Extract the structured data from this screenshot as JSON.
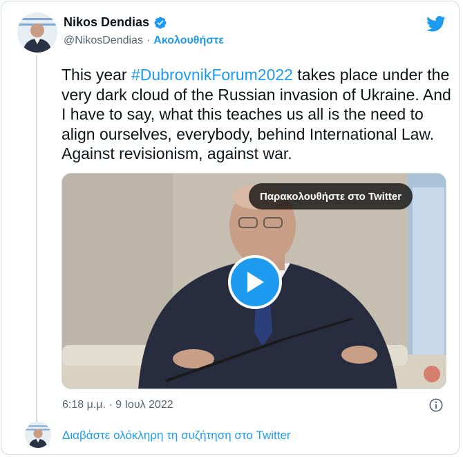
{
  "author": {
    "name": "Nikos Dendias",
    "handle": "@NikosDendias",
    "separator": "·",
    "follow_label": "Ακολουθήστε"
  },
  "tweet": {
    "text_before": "This year ",
    "hashtag": "#DubrovnikForum2022",
    "text_after": " takes place under the very dark cloud of the Russian invasion of Ukraine. And I have to say, what this teaches us all is the need to align ourselves, everybody, behind International Law. Against revisionism, against war."
  },
  "media": {
    "watch_label": "Παρακολουθήστε στο Twitter",
    "play_icon": "play-icon"
  },
  "meta": {
    "timestamp": "6:18 μ.μ. · 9 Ιουλ 2022"
  },
  "footer": {
    "read_more_label": "Διαβάστε ολόκληρη τη συζήτηση στο Twitter"
  },
  "colors": {
    "accent": "#1d9bf0",
    "text": "#0f1419",
    "muted": "#536471",
    "border": "#cfd9de"
  }
}
